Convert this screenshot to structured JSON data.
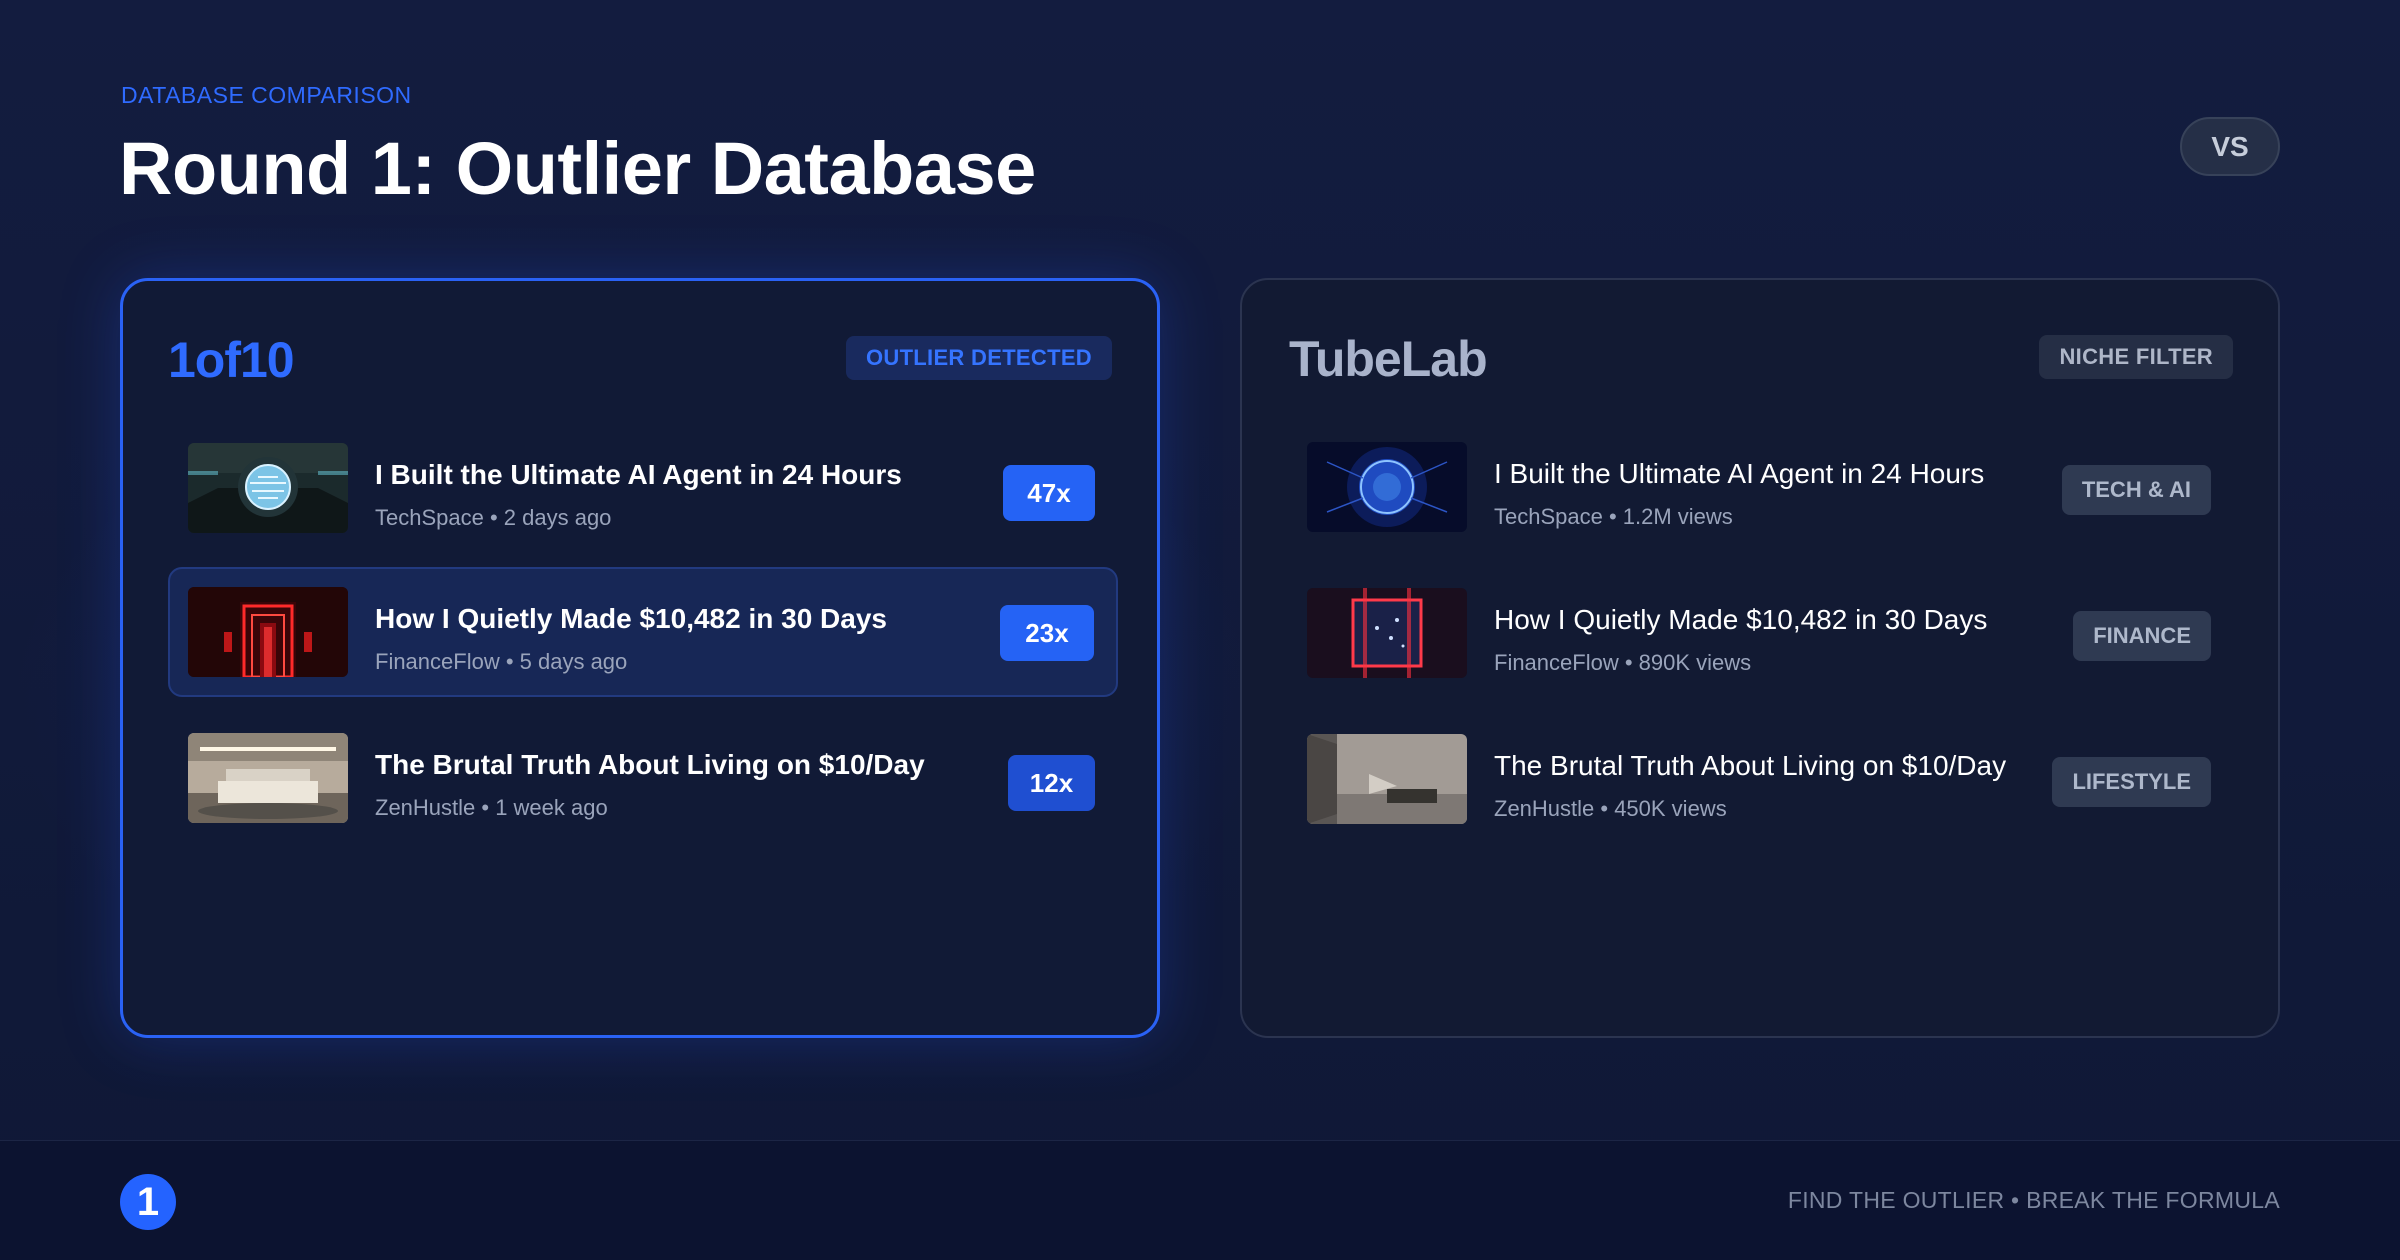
{
  "header": {
    "eyebrow": "DATABASE COMPARISON",
    "title": "Round 1: Outlier Database",
    "vs_label": "VS"
  },
  "left_panel": {
    "brand": "1of10",
    "tag": "OUTLIER DETECTED",
    "rows": [
      {
        "title": "I Built the Ultimate AI Agent in 24 Hours",
        "meta": "TechSpace • 2 days ago",
        "multiplier": "47x",
        "thumbnail": "glowing-orb-room"
      },
      {
        "title": "How I Quietly Made $10,482 in 30 Days",
        "meta": "FinanceFlow • 5 days ago",
        "multiplier": "23x",
        "thumbnail": "red-neon-doorway"
      },
      {
        "title": "The Brutal Truth About Living on $10/Day",
        "meta": "ZenHustle • 1 week ago",
        "multiplier": "12x",
        "thumbnail": "minimal-bedroom"
      }
    ]
  },
  "right_panel": {
    "brand": "TubeLab",
    "tag": "NICHE FILTER",
    "rows": [
      {
        "title": "I Built the Ultimate AI Agent in 24 Hours",
        "meta": "TechSpace • 1.2M views",
        "category": "TECH & AI",
        "thumbnail": "blue-energy-sphere"
      },
      {
        "title": "How I Quietly Made $10,482 in 30 Days",
        "meta": "FinanceFlow • 890K views",
        "category": "FINANCE",
        "thumbnail": "red-frame-galaxy"
      },
      {
        "title": "The Brutal Truth About Living on $10/Day",
        "meta": "ZenHustle • 450K views",
        "category": "LIFESTYLE",
        "thumbnail": "empty-room"
      }
    ]
  },
  "footer": {
    "tagline": "FIND THE OUTLIER • BREAK THE FORMULA",
    "logo_glyph": "1"
  },
  "colors": {
    "accent": "#2f6bff",
    "background": "#131c3f",
    "highlight_row": "#172756"
  }
}
